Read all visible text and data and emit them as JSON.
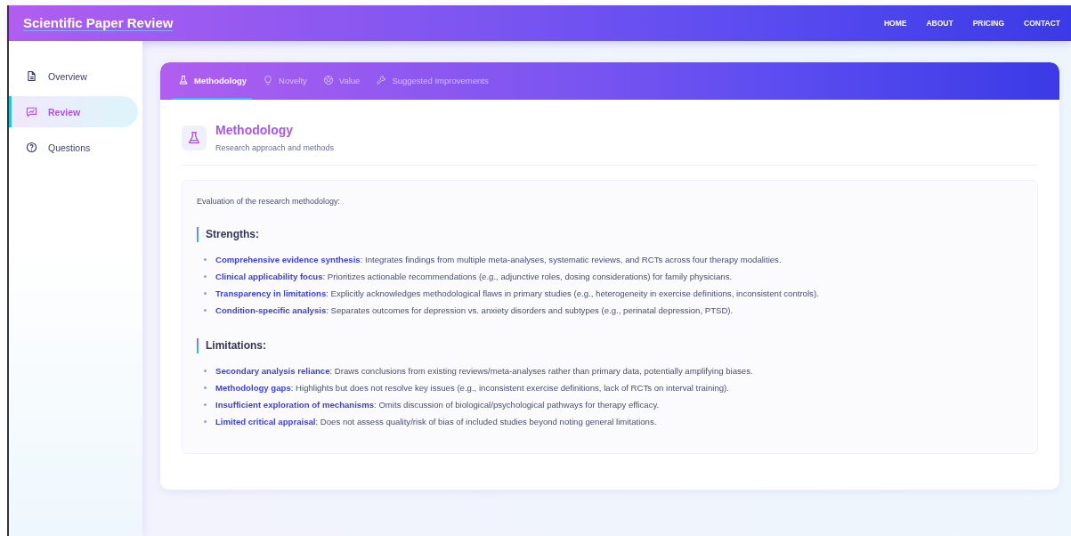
{
  "header": {
    "title": "Scientific Paper Review",
    "nav": [
      "HOME",
      "ABOUT",
      "PRICING",
      "CONTACT"
    ]
  },
  "sidebar": {
    "items": [
      {
        "label": "Overview",
        "kind": "document",
        "selected": false
      },
      {
        "label": "Review",
        "kind": "chart",
        "selected": true
      },
      {
        "label": "Questions",
        "kind": "question",
        "selected": false
      }
    ]
  },
  "tabs": [
    {
      "label": "Methodology",
      "kind": "flask",
      "selected": true
    },
    {
      "label": "Novelty",
      "kind": "bulb",
      "selected": false
    },
    {
      "label": "Value",
      "kind": "ball",
      "selected": false
    },
    {
      "label": "Suggested Improvements",
      "kind": "wrench",
      "selected": false
    }
  ],
  "section": {
    "kind": "flask",
    "title": "Methodology",
    "subtitle": "Research approach and methods",
    "intro": "Evaluation of the research methodology:",
    "groups": [
      {
        "heading": "Strengths:",
        "items": [
          "**Comprehensive evidence synthesis**: Integrates findings from multiple meta-analyses, systematic reviews, and RCTs across four therapy modalities.",
          "**Clinical applicability focus**: Prioritizes actionable recommendations (e.g., adjunctive roles, dosing considerations) for family physicians.",
          "**Transparency in limitations**: Explicitly acknowledges methodological flaws in primary studies (e.g., heterogeneity in exercise definitions, inconsistent controls).",
          "**Condition-specific analysis**: Separates outcomes for depression vs. anxiety disorders and subtypes (e.g., perinatal depression, PTSD)."
        ]
      },
      {
        "heading": "Limitations:",
        "items": [
          "**Secondary analysis reliance**: Draws conclusions from existing reviews/meta-analyses rather than primary data, potentially amplifying biases.",
          "**Methodology gaps**: Highlights but does not resolve key issues (e.g., inconsistent exercise definitions, lack of RCTs on interval training).",
          "**Insufficient exploration of mechanisms**: Omits discussion of biological/psychological pathways for therapy efficacy.",
          "**Limited critical appraisal**: Does not assess quality/risk of bias of included studies beyond noting general limitations."
        ]
      }
    ]
  }
}
